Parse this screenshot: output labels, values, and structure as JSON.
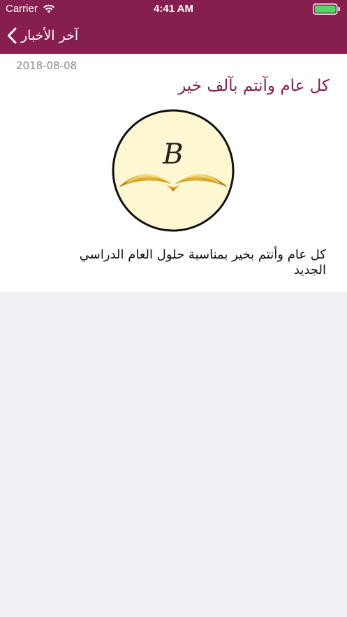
{
  "status_bar": {
    "carrier": "Carrier",
    "time": "4:41 AM",
    "wifi_icon": "wifi-icon",
    "battery_icon": "battery-full-icon"
  },
  "nav": {
    "back_label": "آخر الأخبار",
    "back_icon": "chevron-left-icon",
    "background": "#861f4d"
  },
  "news": {
    "date": "2018-08-08",
    "title": "كل عام وآنتم بآلف خير",
    "logo_letter": "B",
    "body": "كل عام وأنتم بخير بمناسبة حلول العام الدراسي الجديد"
  },
  "colors": {
    "accent": "#861f4d",
    "gold": "#d4a21f",
    "logo_fill": "#fdf8d2"
  }
}
